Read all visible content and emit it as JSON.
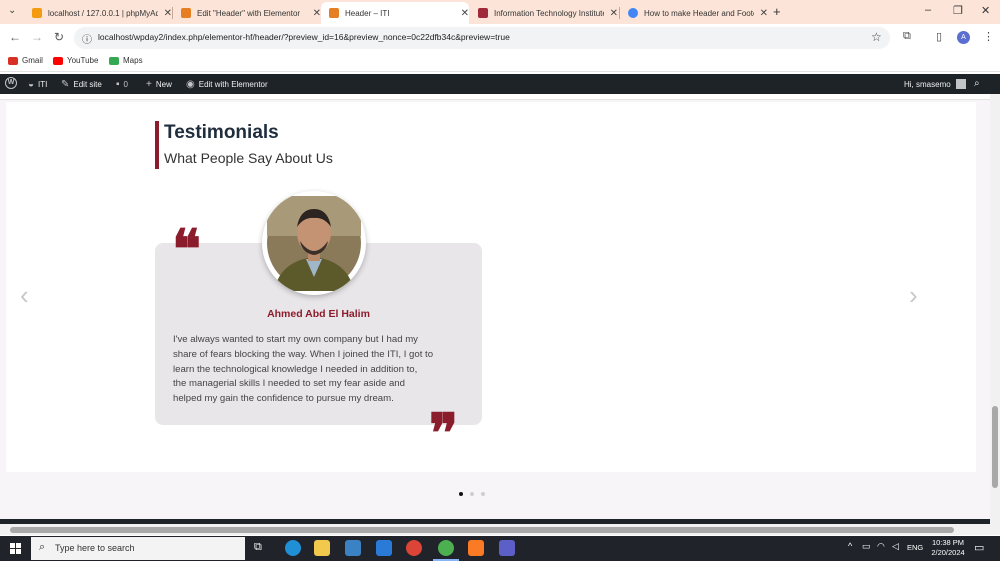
{
  "browser": {
    "tabs": [
      {
        "title": "localhost / 127.0.0.1 | phpMyAdmin",
        "color": "#f39c12",
        "active": false
      },
      {
        "title": "Edit \"Header\" with Elementor",
        "color": "#e67e22",
        "active": false
      },
      {
        "title": "Header – ITI",
        "color": "#e67e22",
        "active": true
      },
      {
        "title": "Information Technology Institute",
        "color": "#a12a3a",
        "active": false
      },
      {
        "title": "How to make Header and Footer",
        "color": "#4285f4",
        "active": false
      }
    ],
    "url": "localhost/wpday2/index.php/elementor-hf/header/?preview_id=16&preview_nonce=0c22dfb34c&preview=true",
    "profile_initial": "A",
    "bookmarks": [
      {
        "label": "Gmail",
        "color": "#d93025"
      },
      {
        "label": "YouTube",
        "color": "#ff0000"
      },
      {
        "label": "Maps",
        "color": "#34a853"
      }
    ]
  },
  "adminbar": {
    "site": "ITI",
    "edit_site": "Edit site",
    "comments": "0",
    "new": "New",
    "edit_elementor": "Edit with Elementor",
    "greeting": "Hi, smasemo"
  },
  "section": {
    "title": "Testimonials",
    "subtitle": "What People Say About Us"
  },
  "testimonial": {
    "name": "Ahmed Abd El Halim",
    "lines": [
      "I've always wanted to start my own company but I had my",
      "share of fears blocking the way. When I joined the ITI, I got to",
      "learn the technological knowledge I needed in addition to,",
      "the managerial skills I needed to set my fear aside and",
      "helped my gain the confidence to pursue my dream."
    ]
  },
  "carousel": {
    "prev": "‹",
    "next": "›",
    "slide_count": 3,
    "active_index": 0
  },
  "taskbar": {
    "search_placeholder": "Type here to search",
    "language": "ENG",
    "time": "10:38 PM",
    "date": "2/20/2024"
  },
  "colors": {
    "accent": "#8b1c2c",
    "heading": "#1f2d3d",
    "card": "#e9e6ea"
  }
}
